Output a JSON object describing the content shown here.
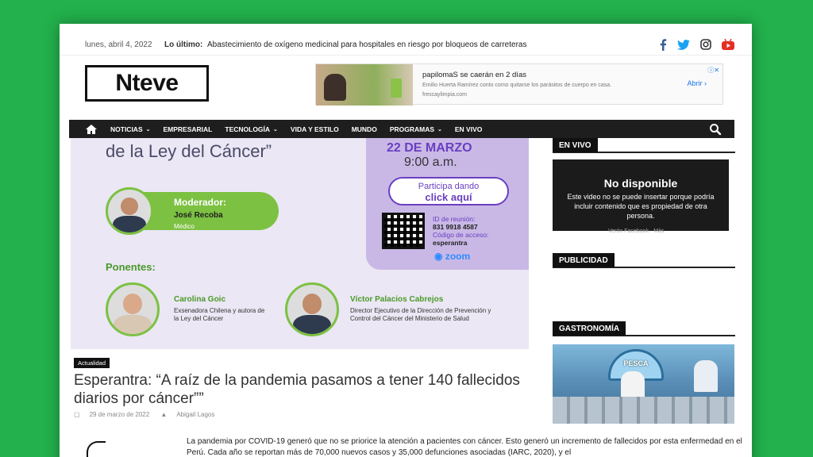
{
  "topbar": {
    "date": "lunes, abril 4, 2022",
    "latest_label": "Lo último:",
    "latest_text": "Abastecimiento de oxígeno medicinal para hospitales en riesgo por bloqueos de carreteras",
    "social_icons": [
      "facebook-icon",
      "twitter-icon",
      "instagram-icon",
      "youtube-icon"
    ]
  },
  "logo": {
    "text": "Nteve"
  },
  "ad": {
    "title": "papilomaS se caerán en 2 días",
    "description": "Emilio Huerta Ramírez conto como quitarse los parásitos de cuerpo en casa.",
    "domain": "frescaylimpia.com",
    "cta": "Abrir"
  },
  "nav": {
    "items": [
      "NOTICIAS",
      "EMPRESARIAL",
      "TECNOLOGÍA",
      "VIDA Y ESTILO",
      "MUNDO",
      "PROGRAMAS",
      "EN VIVO"
    ],
    "dropdown_flags": [
      true,
      false,
      true,
      false,
      false,
      true,
      false
    ]
  },
  "hero": {
    "heading": "de la Ley del Cáncer”",
    "date": "22 DE MARZO",
    "time": "9:00 a.m.",
    "cta_line1": "Participa dando",
    "cta_line2": "click aquí",
    "meeting_id_label": "ID de reunión:",
    "meeting_id": "831 9918 4587",
    "access_label": "Código de acceso:",
    "access_code": "esperantra",
    "zoom_label": "zoom",
    "moderator_role": "Moderador:",
    "moderator_name": "José Recoba",
    "moderator_title": "Médico",
    "speakers_label": "Ponentes:",
    "speakers": [
      {
        "name": "Carolina Goic",
        "description": "Exsenadora Chilena y autora de la Ley del Cáncer"
      },
      {
        "name": "Víctor Palacios Cabrejos",
        "description": "Director Ejecutivo de la Dirección de Prevención y Control del Cáncer del Ministerio de Salud"
      }
    ]
  },
  "article": {
    "category": "Actualidad",
    "headline": "Esperantra: “A raíz de la pandemia pasamos a tener 140 fallecidos diarios por cáncer””",
    "date": "29 de marzo de 2022",
    "author": "Abigail Lagos",
    "lead": "La pandemia por COVID-19 generó que no se priorice la atención a pacientes con cáncer. Esto generó un incremento de fallecidos por esta enfermedad en el Perú. Cada año se reportan más de 70,000 nuevos casos y 35,000 defunciones asociadas (IARC, 2020), y el"
  },
  "sidebar": {
    "live_heading": "EN VIVO",
    "video_title": "No disponible",
    "video_desc": "Este video no se puede insertar porque podría incluir contenido que es propiedad de otra persona.",
    "video_cut": "Verón Facebook · Más",
    "ad_heading": "PUBLICIDAD",
    "food_heading": "GASTRONOMÍA",
    "food_sign": "PESCA"
  },
  "colors": {
    "background": "#22b14c",
    "nav": "#1e1e1e",
    "accent_purple": "#6a3fc0",
    "accent_green": "#7cc142"
  }
}
